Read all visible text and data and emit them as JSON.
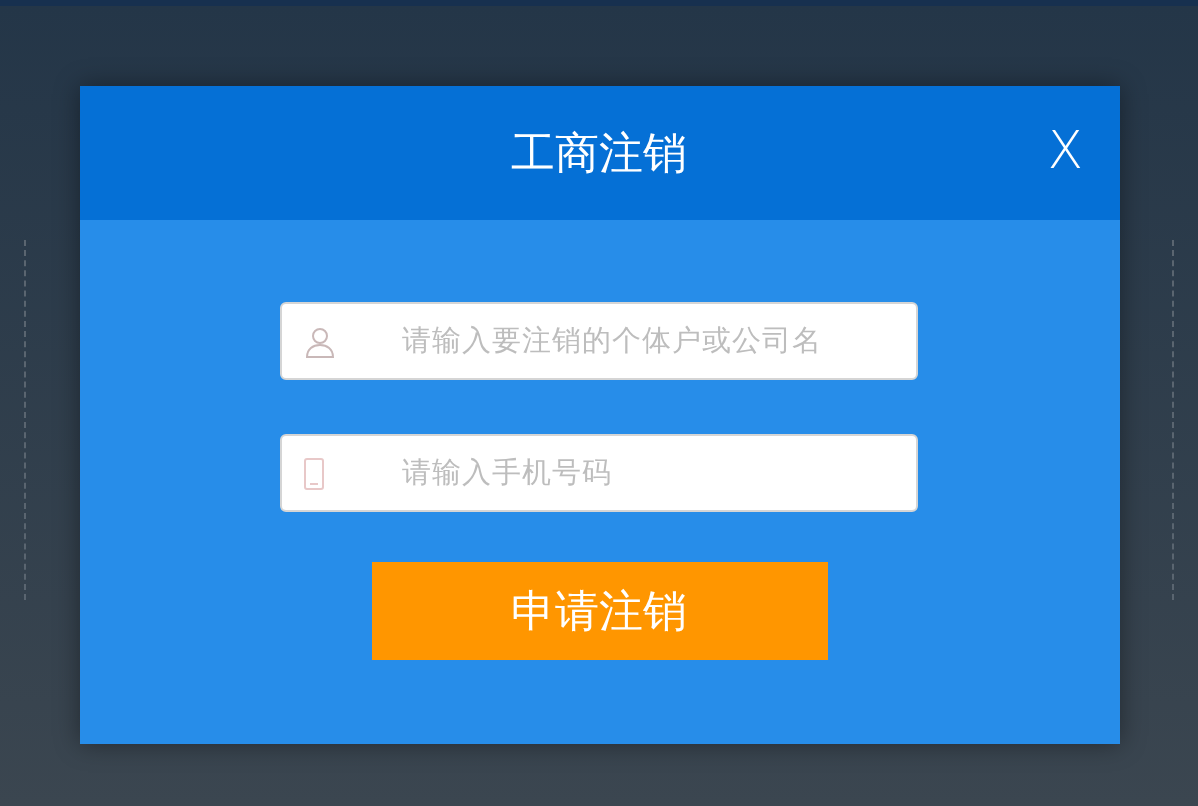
{
  "dialog": {
    "title": "工商注销",
    "close": "X"
  },
  "fields": [
    {
      "kind": "person",
      "placeholder": "请输入要注销的个体户或公司名"
    },
    {
      "kind": "phone",
      "placeholder": "请输入手机号码"
    }
  ],
  "submit": "申请注销"
}
